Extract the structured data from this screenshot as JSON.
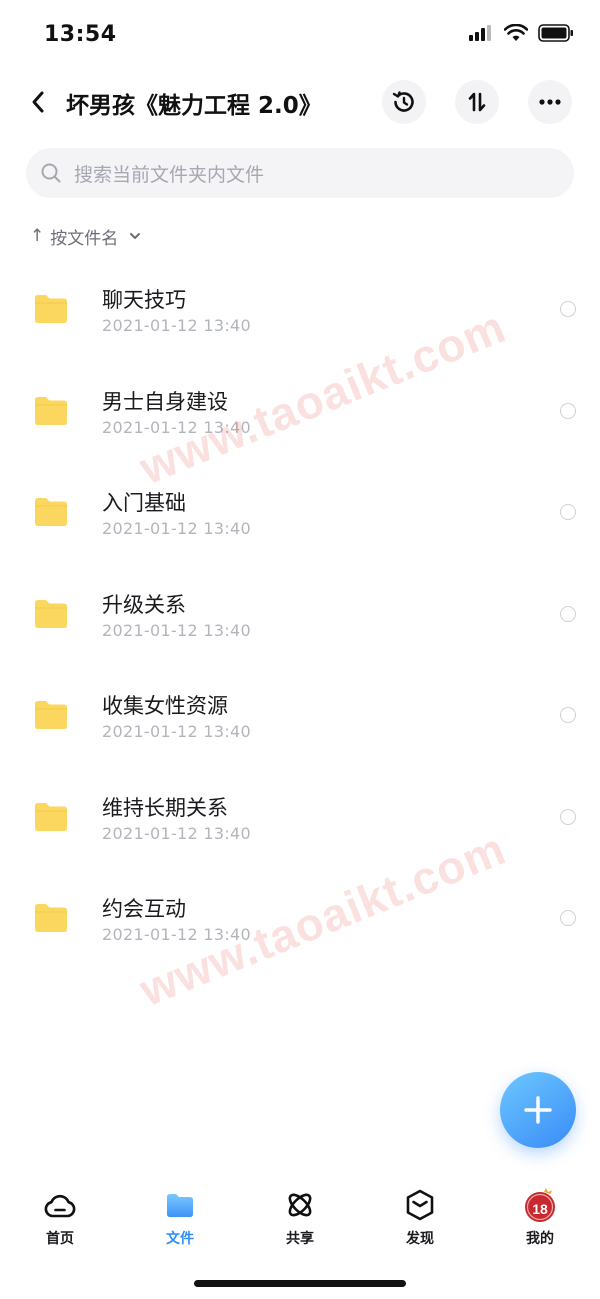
{
  "status": {
    "time": "13:54"
  },
  "nav": {
    "title": "坏男孩《魅力工程 2.0》"
  },
  "search": {
    "placeholder": "搜索当前文件夹内文件"
  },
  "sort": {
    "arrow": "↑",
    "label": "按文件名"
  },
  "files": [
    {
      "name": "聊天技巧",
      "date": "2021-01-12 13:40"
    },
    {
      "name": "男士自身建设",
      "date": "2021-01-12 13:40"
    },
    {
      "name": "入门基础",
      "date": "2021-01-12 13:40"
    },
    {
      "name": "升级关系",
      "date": "2021-01-12 13:40"
    },
    {
      "name": "收集女性资源",
      "date": "2021-01-12 13:40"
    },
    {
      "name": "维持长期关系",
      "date": "2021-01-12 13:40"
    },
    {
      "name": "约会互动",
      "date": "2021-01-12 13:40"
    }
  ],
  "watermark": {
    "text": "www.taoaikt.com"
  },
  "tabs": [
    {
      "label": "首页",
      "icon": "cloud-home-icon",
      "active": false
    },
    {
      "label": "文件",
      "icon": "folder-icon",
      "active": true
    },
    {
      "label": "共享",
      "icon": "atom-share-icon",
      "active": false
    },
    {
      "label": "发现",
      "icon": "hexagon-discover-icon",
      "active": false
    },
    {
      "label": "我的",
      "icon": "avatar-icon",
      "active": false
    }
  ],
  "avatar": {
    "text": "18"
  },
  "colors": {
    "accent": "#2f8df7",
    "folder": "#fcd760",
    "fab_start": "#6cc8ff",
    "fab_end": "#3a8bf7",
    "watermark": "#e65a50",
    "avatar": "#c8282e"
  }
}
